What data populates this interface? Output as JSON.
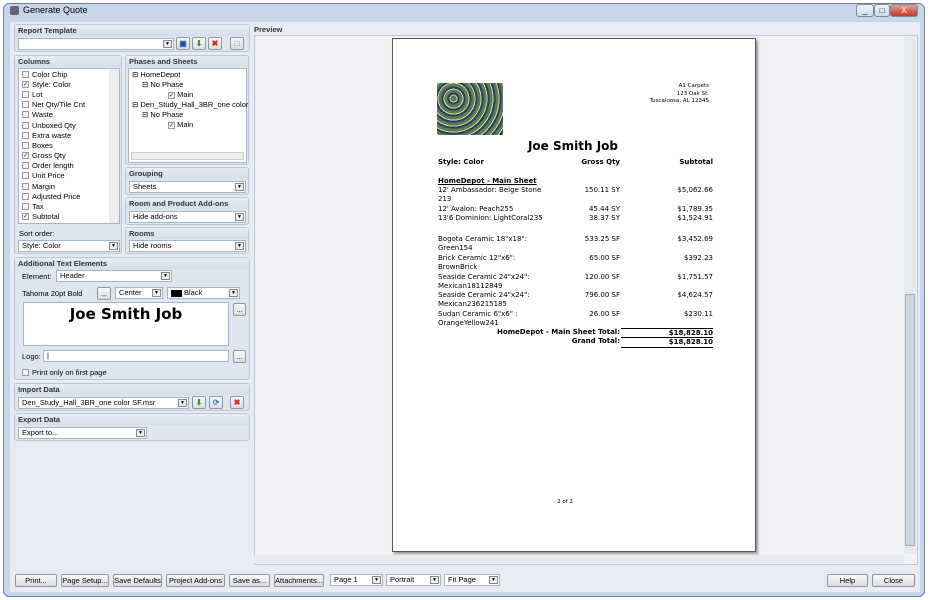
{
  "window": {
    "title": "Generate Quote",
    "min": "_",
    "max": "□",
    "close": "X"
  },
  "report_template": {
    "label": "Report Template",
    "value": ""
  },
  "columns": {
    "label": "Columns",
    "items": [
      {
        "label": "Color Chip",
        "checked": false
      },
      {
        "label": "Style: Color",
        "checked": true
      },
      {
        "label": "Lot",
        "checked": false
      },
      {
        "label": "Net Qty/Tile Cnt",
        "checked": false
      },
      {
        "label": "Waste",
        "checked": false
      },
      {
        "label": "Unboxed Qty",
        "checked": false
      },
      {
        "label": "Extra waste",
        "checked": false
      },
      {
        "label": "Boxes",
        "checked": false
      },
      {
        "label": "Gross Qty",
        "checked": true
      },
      {
        "label": "Order length",
        "checked": false
      },
      {
        "label": "Unit Price",
        "checked": false
      },
      {
        "label": "Margin",
        "checked": false
      },
      {
        "label": "Adjusted Price",
        "checked": false
      },
      {
        "label": "Tax",
        "checked": false
      },
      {
        "label": "Subtotal",
        "checked": true
      }
    ],
    "sort_label": "Sort order:",
    "sort_value": "Style: Color"
  },
  "phases": {
    "label": "Phases and Sheets",
    "tree": [
      "HomeDepot",
      "No Phase",
      "Main",
      "Den_Study_Hall_3BR_one color",
      "No Phase",
      "Main"
    ]
  },
  "grouping": {
    "label": "Grouping",
    "value": "Sheets"
  },
  "addons": {
    "label": "Room and Product Add-ons",
    "value": "Hide add-ons"
  },
  "rooms": {
    "label": "Rooms",
    "value": "Hide rooms"
  },
  "text_elements": {
    "label": "Additional Text Elements",
    "element_label": "Element:",
    "element_value": "Header",
    "font": "Tahoma 20pt Bold",
    "browse": "...",
    "align": "Center",
    "color": "Black",
    "color_hex": "#000000",
    "text": "Joe Smith Job",
    "logo_label": "Logo:",
    "logo_value": "",
    "first_page_label": "Print only on first page"
  },
  "import": {
    "label": "Import Data",
    "value": "Den_Study_Hall_3BR_one color SF.msr"
  },
  "export": {
    "label": "Export Data",
    "value": "Export to..."
  },
  "preview": {
    "label": "Preview",
    "company": [
      "A1 Carpets",
      "123 Oak St.",
      "Tuscaloosa, AL 12345"
    ],
    "title": "Joe Smith Job",
    "headers": [
      "Style: Color",
      "Gross Qty",
      "Subtotal"
    ],
    "section": "HomeDepot - Main Sheet",
    "rows": [
      {
        "desc": "12' Ambassador: Beige Stone 213",
        "qty": "150.11 SY",
        "sub": "$5,062.66"
      },
      {
        "desc": "12' Avalon: Peach255",
        "qty": "45.44 SY",
        "sub": "$1,789.35"
      },
      {
        "desc": "13'6 Dominion: LightCoral235",
        "qty": "38.37 SY",
        "sub": "$1,524.91"
      },
      {
        "desc": "Bogota Ceramic 18\"x18\": Green154",
        "qty": "533.25 SF",
        "sub": "$3,452.69"
      },
      {
        "desc": "Brick Ceramic 12\"x6\": BrownBrick",
        "qty": "65.00 SF",
        "sub": "$392.23"
      },
      {
        "desc": "Seaside Ceramic 24\"x24\": Mexican18112849",
        "qty": "120.00 SF",
        "sub": "$1,751.57"
      },
      {
        "desc": "Seaside Ceramic 24\"x24\": Mexican236215185",
        "qty": "796.00 SF",
        "sub": "$4,624.57"
      },
      {
        "desc": "Sudan Ceramic 6\"x6\" : OrangeYellow241",
        "qty": "26.00 SF",
        "sub": "$230.11"
      }
    ],
    "section_total_label": "HomeDepot - Main Sheet Total:",
    "section_total": "$18,828.10",
    "grand_total_label": "Grand Total:",
    "grand_total": "$18,828.10",
    "page_number": "2 of 2"
  },
  "footer": {
    "print": "Print...",
    "page_setup": "Page Setup...",
    "save_defaults": "Save Defaults",
    "project_addons": "Project Add-ons",
    "save_as": "Save as...",
    "attachments": "Attachments...",
    "page": "Page 1",
    "orientation": "Portrait",
    "zoom": "Fit Page",
    "help": "Help",
    "close": "Close"
  }
}
